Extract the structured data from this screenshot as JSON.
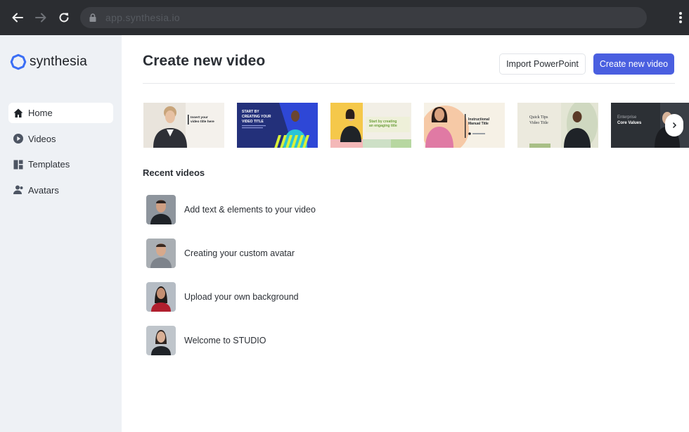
{
  "browser": {
    "url": "app.synthesia.io"
  },
  "sidebar": {
    "logo_text": "synthesia",
    "items": [
      {
        "label": "Home",
        "icon": "home-icon",
        "active": true
      },
      {
        "label": "Videos",
        "icon": "play-circle-icon",
        "active": false
      },
      {
        "label": "Templates",
        "icon": "templates-icon",
        "active": false
      },
      {
        "label": "Avatars",
        "icon": "avatars-icon",
        "active": false
      }
    ]
  },
  "header": {
    "title": "Create new video",
    "import_button": "Import PowerPoint",
    "create_button": "Create new video"
  },
  "templates": [
    {
      "text_1": "Insert your",
      "text_2": "video title here"
    },
    {
      "text_1": "START BY",
      "text_2": "CREATING YOUR",
      "text_3": "VIDEO TITLE"
    },
    {
      "text_1": "Start by creating",
      "text_2": "an engaging title"
    },
    {
      "text_1": "Instructional",
      "text_2": "Manual Title"
    },
    {
      "text_1": "Quick Tips",
      "text_2": "Video Title"
    },
    {
      "text_1": "Enterprise",
      "text_2": "Core Values"
    }
  ],
  "recent": {
    "title": "Recent videos",
    "items": [
      {
        "title": "Add text & elements to your video"
      },
      {
        "title": "Creating your custom avatar"
      },
      {
        "title": "Upload your own background"
      },
      {
        "title": "Welcome to STUDIO"
      }
    ]
  },
  "colors": {
    "accent": "#4a5fe0",
    "sidebar_bg": "#eef1f5",
    "logo_blue": "#3b6ef5"
  }
}
